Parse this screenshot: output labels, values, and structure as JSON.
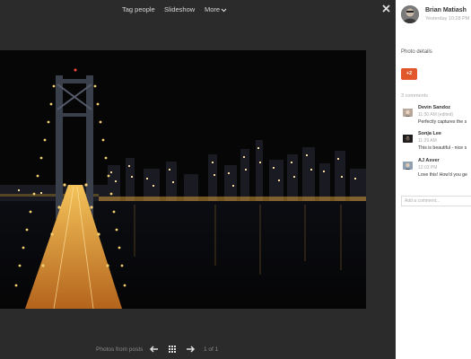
{
  "topbar": {
    "tag_people": "Tag people",
    "slideshow": "Slideshow",
    "more": "More"
  },
  "bottombar": {
    "label": "Photos from posts",
    "count": "1 of 1"
  },
  "author": {
    "name": "Brian Matiash",
    "time": "Yesterday 10:28 PM"
  },
  "photo_details_label": "Photo details",
  "plus_button": "+2",
  "comments_count": "3 comments",
  "comments": [
    {
      "name": "Devin Sandoz",
      "time": "11:30 AM (edited)",
      "text": "Perfectly captures the s"
    },
    {
      "name": "Sonja Lee",
      "time": "11:29 AM",
      "text": "This is beautiful - nice s"
    },
    {
      "name": "AJ Asver",
      "time": "12:03 PM",
      "text": "Love this! How'd you ge"
    }
  ],
  "add_comment_placeholder": "Add a comment...",
  "colors": {
    "viewer_bg": "#2b2b2b",
    "plus_accent": "#e2562c",
    "bridge_glow": "#e8a53a"
  }
}
